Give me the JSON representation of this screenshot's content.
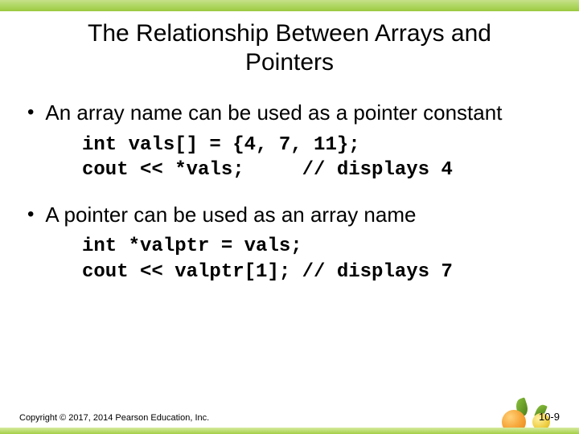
{
  "title": "The Relationship Between Arrays and Pointers",
  "bullets": [
    {
      "text": "An array name can be used as a pointer constant",
      "code": "int vals[] = {4, 7, 11};\ncout << *vals;     // displays 4"
    },
    {
      "text": "A pointer can be used as an array name",
      "code": "int *valptr = vals;\ncout << valptr[1]; // displays 7"
    }
  ],
  "footer": {
    "copyright": "Copyright © 2017, 2014 Pearson Education, Inc.",
    "page": "10-9"
  }
}
